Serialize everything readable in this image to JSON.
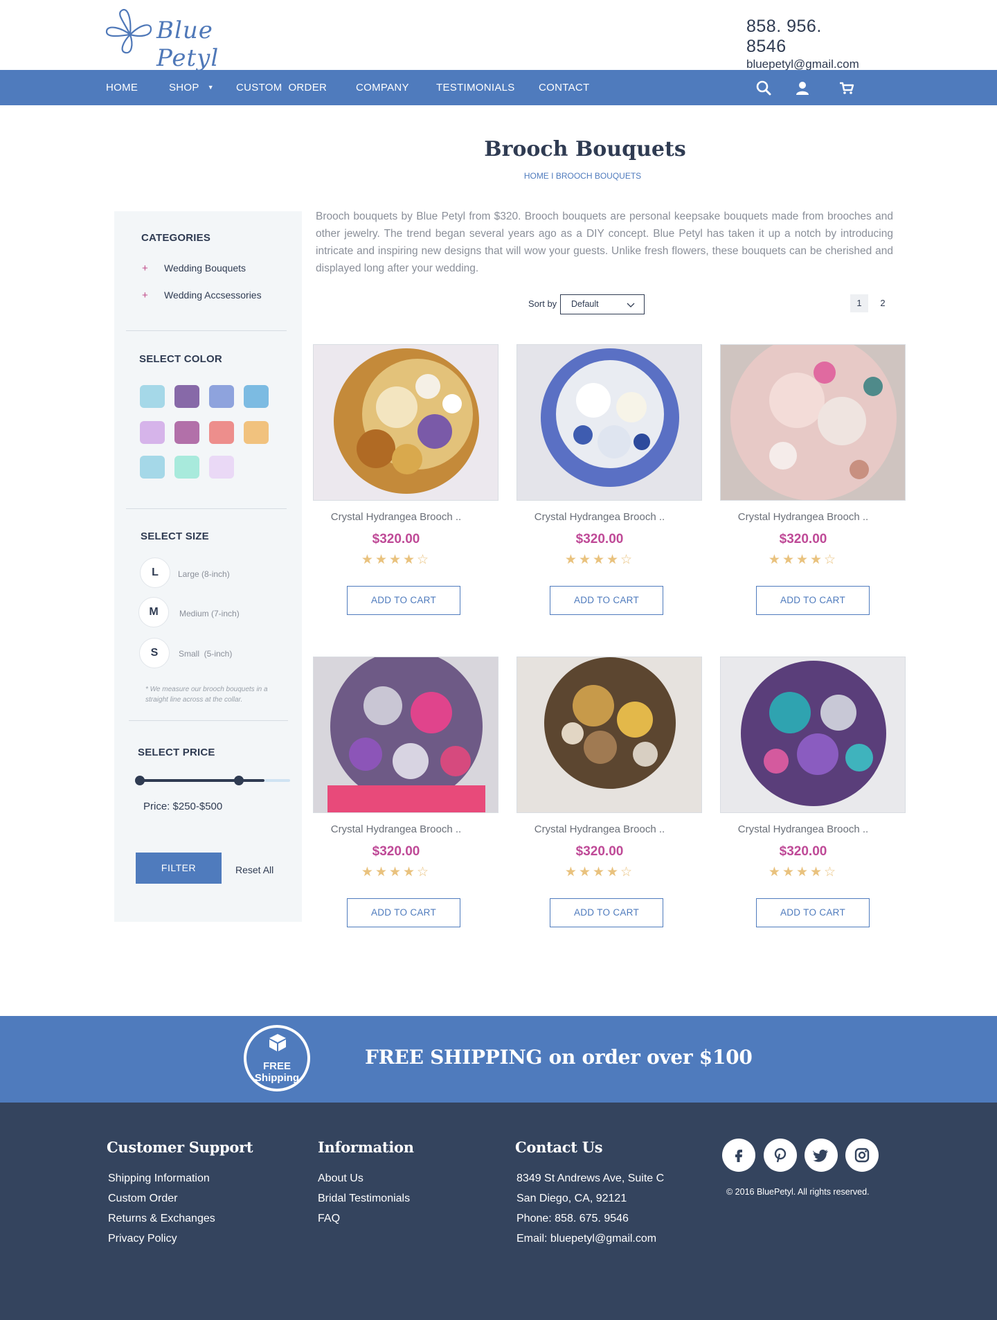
{
  "brand": {
    "name": "Blue Petyl"
  },
  "header": {
    "phone": "858. 956. 8546",
    "email": "bluepetyl@gmail.com"
  },
  "nav": {
    "items": [
      {
        "label": "HOME"
      },
      {
        "label": "SHOP"
      },
      {
        "label": "CUSTOM  ORDER"
      },
      {
        "label": "COMPANY"
      },
      {
        "label": "TESTIMONIALS"
      },
      {
        "label": "CONTACT"
      }
    ],
    "icons": [
      "search-icon",
      "user-icon",
      "cart-icon"
    ]
  },
  "page": {
    "title": "Brooch Bouquets",
    "breadcrumb": "HOME I  BROOCH BOUQUETS",
    "description": "Brooch bouquets by Blue Petyl from $320. Brooch bouquets are personal keepsake bouquets made from brooches and other jewelry. The trend began several years ago as a DIY concept. Blue Petyl has taken it up a notch by introducing intricate and inspiring new designs that will wow your guests. Unlike fresh flowers, these bouquets can be cherished and displayed long after your wedding."
  },
  "sidebar": {
    "categories_heading": "CATEGORIES",
    "categories": [
      {
        "label": "Wedding Bouquets"
      },
      {
        "label": "Wedding Accsessories"
      }
    ],
    "color_heading": "SELECT COLOR",
    "colors": [
      "#a5d8e8",
      "#8769a8",
      "#8ea3dd",
      "#7cbbe2",
      "#d6b4ea",
      "#b270a9",
      "#ed8e8c",
      "#f1c27e",
      "#a5d8e8",
      "#a8eadc",
      "#ead9f6"
    ],
    "size_heading": "SELECT SIZE",
    "sizes": [
      {
        "letter": "L",
        "label": "Large (8-inch)"
      },
      {
        "letter": "M",
        "label": "Medium (7-inch)"
      },
      {
        "letter": "S",
        "label": "Small  (5-inch)"
      }
    ],
    "size_note": "* We measure our brooch bouquets in a straight line across at the collar.",
    "price_heading": "SELECT PRICE",
    "price_label": "Price: $250-$500",
    "filter_label": "FILTER",
    "reset_label": "Reset All"
  },
  "sort": {
    "label": "Sort by",
    "value": "Default"
  },
  "pagination": {
    "pages": [
      "1",
      "2"
    ],
    "current": "1"
  },
  "products": [
    {
      "name": "Crystal Hydrangea Brooch ..",
      "price": "$320.00",
      "stars": "★★★★☆",
      "rating": 4,
      "button": "ADD TO CART"
    },
    {
      "name": "Crystal Hydrangea Brooch ..",
      "price": "$320.00",
      "stars": "★★★★☆",
      "rating": 4,
      "button": "ADD TO CART"
    },
    {
      "name": "Crystal Hydrangea Brooch ..",
      "price": "$320.00",
      "stars": "★★★★☆",
      "rating": 4,
      "button": "ADD TO CART"
    },
    {
      "name": "Crystal Hydrangea Brooch ..",
      "price": "$320.00",
      "stars": "★★★★☆",
      "rating": 4,
      "button": "ADD TO CART"
    },
    {
      "name": "Crystal Hydrangea Brooch ..",
      "price": "$320.00",
      "stars": "★★★★☆",
      "rating": 4,
      "button": "ADD TO CART"
    },
    {
      "name": "Crystal Hydrangea Brooch ..",
      "price": "$320.00",
      "stars": "★★★★☆",
      "rating": 4,
      "button": "ADD TO CART"
    }
  ],
  "shipping": {
    "badge_line1": "FREE",
    "badge_line2": "Shipping",
    "text": "FREE SHIPPING on order over $100"
  },
  "footer": {
    "support": {
      "heading": "Customer Support",
      "links": [
        "Shipping Information",
        "Custom Order",
        "Returns & Exchanges",
        "Privacy Policy"
      ]
    },
    "information": {
      "heading": "Information",
      "links": [
        "About Us",
        "Bridal Testimonials",
        "FAQ"
      ]
    },
    "contact": {
      "heading": "Contact Us",
      "lines": [
        "8349 St Andrews Ave, Suite C",
        "San Diego, CA, 92121",
        "Phone: 858. 675. 9546",
        "Email: bluepetyl@gmail.com"
      ]
    },
    "social": [
      "facebook-icon",
      "pinterest-icon",
      "twitter-icon",
      "instagram-icon"
    ],
    "copyright": "© 2016 BluePetyl. All rights reserved."
  },
  "colors": {
    "brand_blue": "#4f7bbd",
    "navy": "#34445e",
    "price_pink": "#bf4a97",
    "star_gold": "#e9c27e"
  }
}
